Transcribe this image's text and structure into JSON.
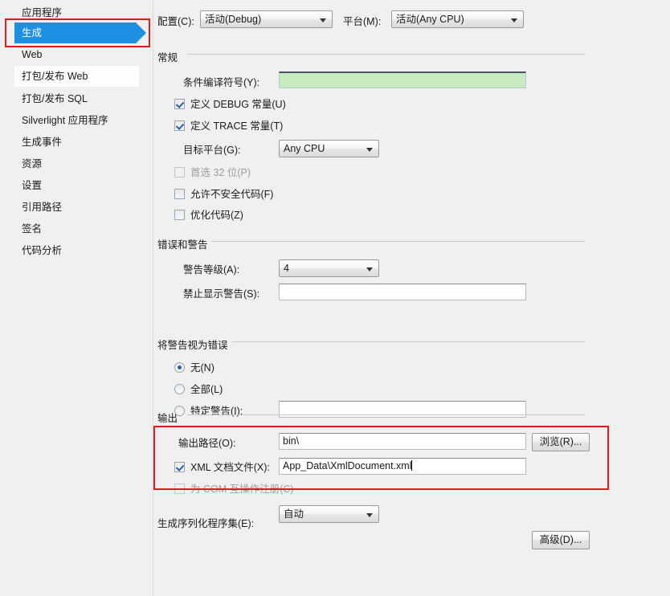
{
  "sidebar": {
    "items": [
      {
        "label": "应用程序",
        "state": "normal"
      },
      {
        "label": "生成",
        "state": "selected"
      },
      {
        "label": "Web",
        "state": "normal"
      },
      {
        "label": "打包/发布 Web",
        "state": "hovered"
      },
      {
        "label": "打包/发布 SQL",
        "state": "normal"
      },
      {
        "label": "Silverlight 应用程序",
        "state": "normal"
      },
      {
        "label": "生成事件",
        "state": "normal"
      },
      {
        "label": "资源",
        "state": "normal"
      },
      {
        "label": "设置",
        "state": "normal"
      },
      {
        "label": "引用路径",
        "state": "normal"
      },
      {
        "label": "签名",
        "state": "normal"
      },
      {
        "label": "代码分析",
        "state": "normal"
      }
    ]
  },
  "top": {
    "configuration_label": "配置(C):",
    "configuration_value": "活动(Debug)",
    "platform_label": "平台(M):",
    "platform_value": "活动(Any CPU)"
  },
  "general": {
    "title": "常规",
    "conditional_symbols_label": "条件编译符号(Y):",
    "conditional_symbols_value": "",
    "define_debug_label": "定义 DEBUG 常量(U)",
    "define_debug_checked": true,
    "define_trace_label": "定义 TRACE 常量(T)",
    "define_trace_checked": true,
    "target_platform_label": "目标平台(G):",
    "target_platform_value": "Any CPU",
    "prefer32_label": "首选 32 位(P)",
    "prefer32_checked": false,
    "prefer32_disabled": true,
    "unsafe_label": "允许不安全代码(F)",
    "unsafe_checked": false,
    "optimize_label": "优化代码(Z)",
    "optimize_checked": false
  },
  "errors": {
    "title": "错误和警告",
    "warning_level_label": "警告等级(A):",
    "warning_level_value": "4",
    "suppress_warnings_label": "禁止显示警告(S):",
    "suppress_warnings_value": ""
  },
  "treat_warnings": {
    "title": "将警告视为错误",
    "none_label": "无(N)",
    "all_label": "全部(L)",
    "specific_label": "特定警告(I):",
    "specific_value": "",
    "selected": "none"
  },
  "output": {
    "title": "输出",
    "output_path_label": "输出路径(O):",
    "output_path_value": "bin\\",
    "browse_button": "浏览(R)...",
    "xml_doc_label": "XML 文档文件(X):",
    "xml_doc_checked": true,
    "xml_doc_value": "App_Data\\XmlDocument.xml",
    "com_interop_label": "为 COM 互操作注册(C)",
    "com_interop_checked": false,
    "serialization_label": "生成序列化程序集(E):",
    "serialization_value": "自动",
    "advanced_button": "高级(D)..."
  },
  "colors": {
    "selection_blue": "#1e90e3",
    "highlight_red": "#e01b1b",
    "field_green": "#c9ebc2",
    "background": "#f0f0f0"
  }
}
